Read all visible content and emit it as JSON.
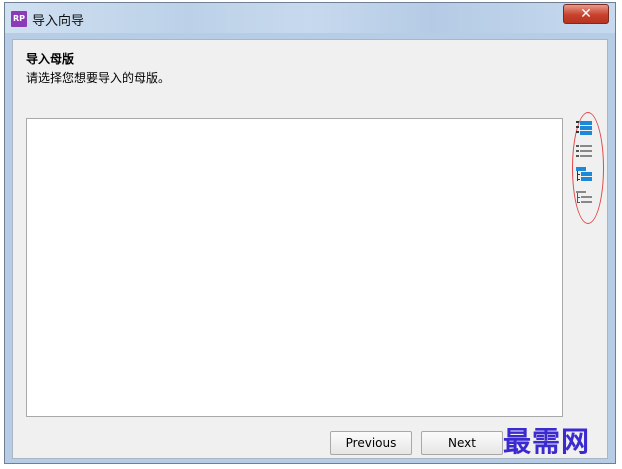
{
  "window": {
    "title": "导入向导",
    "app_icon_text": "RP",
    "close_glyph": "✕"
  },
  "content": {
    "heading": "导入母版",
    "subheading": "请选择您想要导入的母版。"
  },
  "toolbar": {
    "icons": [
      "select-all-icon",
      "deselect-all-icon",
      "select-all-children-icon",
      "deselect-all-children-icon"
    ]
  },
  "footer": {
    "previous_label": "Previous",
    "next_label": "Next"
  },
  "watermark": "最需网",
  "colors": {
    "accent_blue": "#1e88d8",
    "annotation_red": "#e34848",
    "app_icon_purple": "#8b3bb5"
  }
}
